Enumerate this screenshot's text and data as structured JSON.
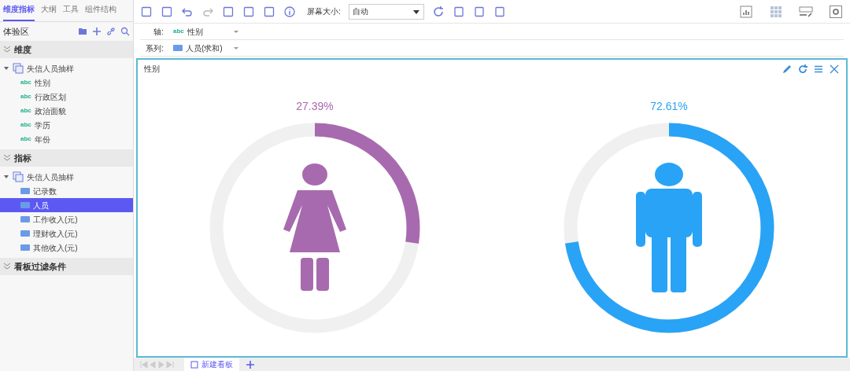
{
  "sidebar": {
    "tabs": [
      {
        "label": "维度指标",
        "selected": true
      },
      {
        "label": "大纲",
        "selected": false
      },
      {
        "label": "工具",
        "selected": false
      },
      {
        "label": "组件结构",
        "selected": false
      }
    ],
    "area_title": "体验区",
    "sections": [
      {
        "title": "维度",
        "expanded": true,
        "tree": [
          {
            "label": "失信人员抽样",
            "expanded": true,
            "children": [
              {
                "label": "性别",
                "tag": "abc",
                "selected": false
              },
              {
                "label": "行政区划",
                "tag": "abc",
                "selected": false
              },
              {
                "label": "政治面貌",
                "tag": "abc",
                "selected": false
              },
              {
                "label": "学历",
                "tag": "abc",
                "selected": false
              },
              {
                "label": "年份",
                "tag": "abc",
                "selected": false
              }
            ]
          }
        ]
      },
      {
        "title": "指标",
        "expanded": true,
        "tree": [
          {
            "label": "失信人员抽样",
            "expanded": true,
            "children": [
              {
                "label": "记录数",
                "selected": false
              },
              {
                "label": "人员",
                "selected": true
              },
              {
                "label": "工作收入(元)",
                "selected": false
              },
              {
                "label": "理财收入(元)",
                "selected": false
              },
              {
                "label": "其他收入(元)",
                "selected": false
              }
            ]
          }
        ]
      },
      {
        "title": "看板过滤条件",
        "expanded": true
      }
    ]
  },
  "toolbar": {
    "screen_size_label": "屏幕大小:",
    "screen_size_value": "自动"
  },
  "bindings": [
    {
      "label": "轴:",
      "tag": "abc",
      "field": "性别"
    },
    {
      "label": "系列:",
      "field": "人员(求和)"
    }
  ],
  "panel": {
    "title": "性别",
    "gauges": [
      {
        "kind": "female",
        "label": "27.39%",
        "level": 0.2739,
        "color": "#a86aae"
      },
      {
        "kind": "male",
        "label": "72.61%",
        "level": 0.7261,
        "color": "#29a3f5"
      }
    ]
  },
  "bottom_tabs": [
    {
      "label": "新建看板",
      "selected": true
    }
  ]
}
